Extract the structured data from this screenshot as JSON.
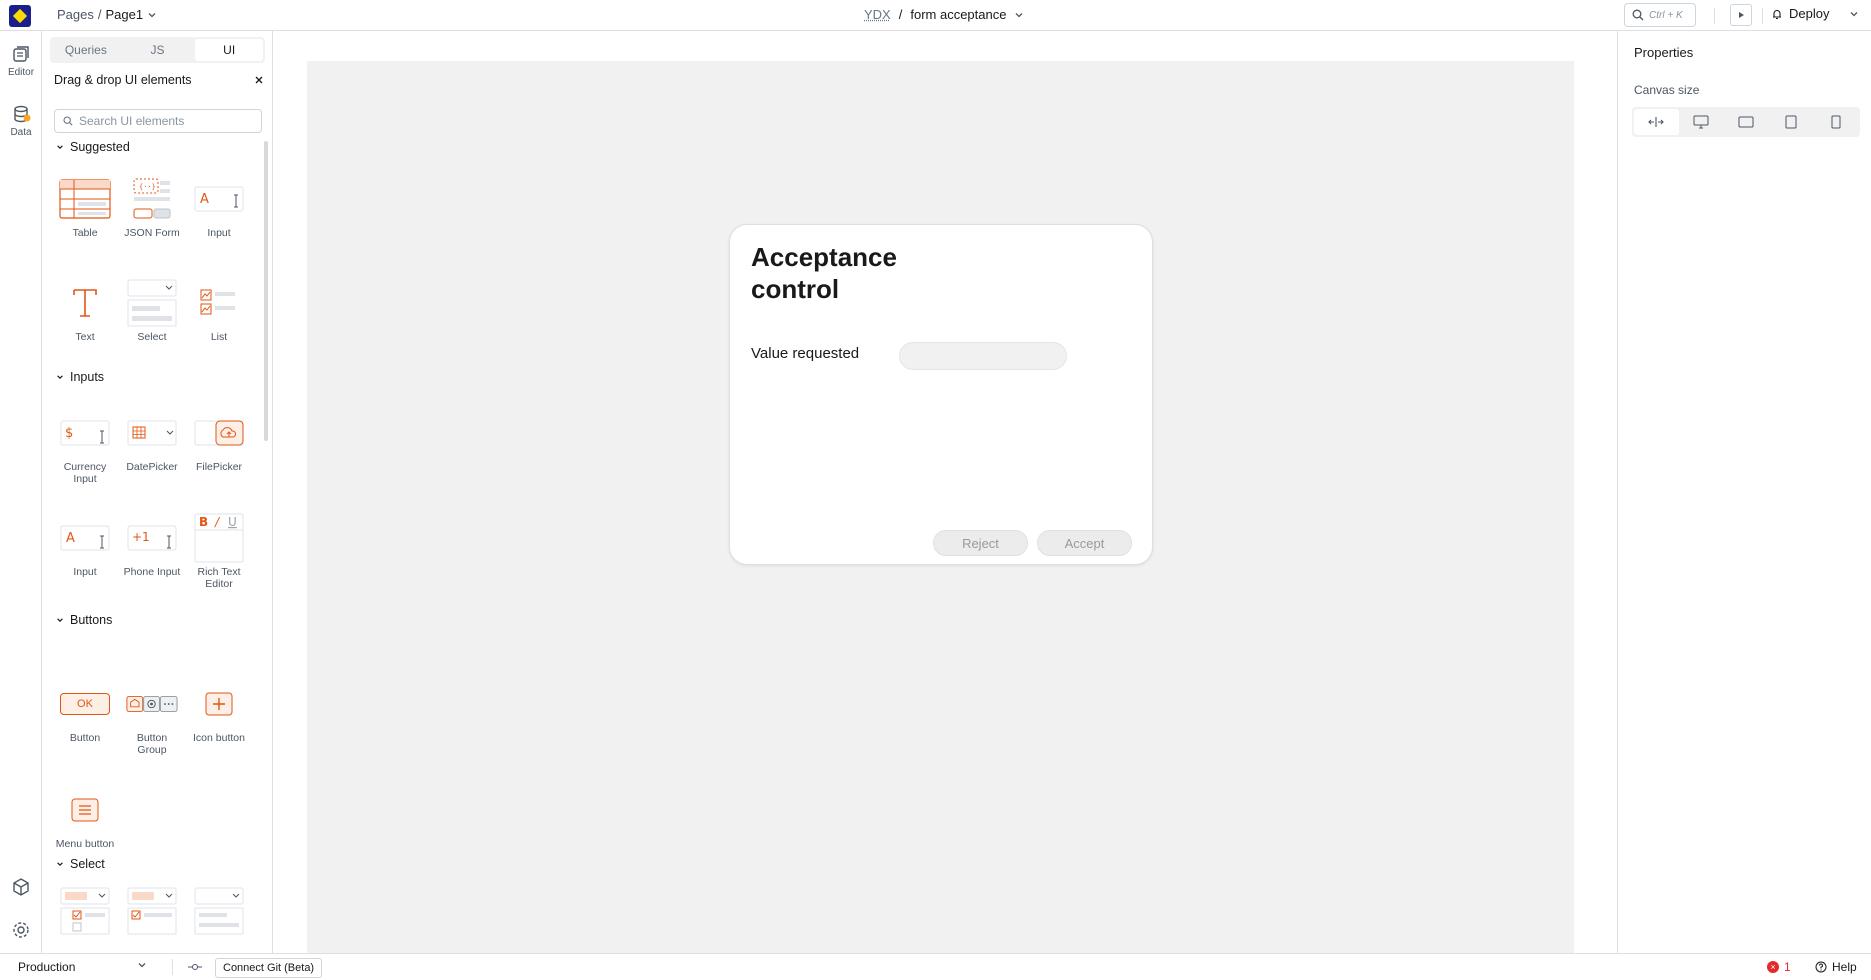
{
  "header": {
    "breadcrumb_root": "Pages",
    "breadcrumb_sep": "/",
    "breadcrumb_page": "Page1",
    "workspace": "YDX",
    "title_sep": "/",
    "app_name": "form acceptance",
    "search_shortcut": "Ctrl + K",
    "deploy_label": "Deploy"
  },
  "rail": {
    "editor_label": "Editor",
    "data_label": "Data"
  },
  "pane": {
    "tabs": [
      "Queries",
      "JS",
      "UI"
    ],
    "active_tab": "UI",
    "heading": "Drag & drop UI elements",
    "search_placeholder": "Search UI elements",
    "sections": {
      "suggested": "Suggested",
      "inputs": "Inputs",
      "buttons": "Buttons",
      "select": "Select"
    },
    "widgets": {
      "table": "Table",
      "json_form": "JSON Form",
      "input": "Input",
      "text": "Text",
      "select": "Select",
      "list": "List",
      "currency_input": "Currency Input",
      "datepicker": "DatePicker",
      "filepicker": "FilePicker",
      "input2": "Input",
      "phone_input": "Phone Input",
      "rich_text_editor": "Rich Text Editor",
      "button": "Button",
      "button_group": "Button Group",
      "icon_button": "Icon button",
      "menu_button": "Menu button"
    },
    "button_icon_text": "OK",
    "phone_icon_text": "+1",
    "input_icon_text": "A",
    "currency_icon_text": "$"
  },
  "canvas": {
    "card_title": "Acceptance control",
    "field_label": "Value requested",
    "field_value": "",
    "reject_label": "Reject",
    "accept_label": "Accept"
  },
  "properties": {
    "title": "Properties",
    "canvas_size_label": "Canvas size"
  },
  "status": {
    "environment": "Production",
    "connect_git": "Connect Git (Beta)",
    "error_count": "1",
    "help": "Help"
  },
  "colors": {
    "brand": "#1b1f8c",
    "brand_accent": "#ffd900",
    "widget_orange": "#e15615",
    "error": "#e22c2c"
  }
}
